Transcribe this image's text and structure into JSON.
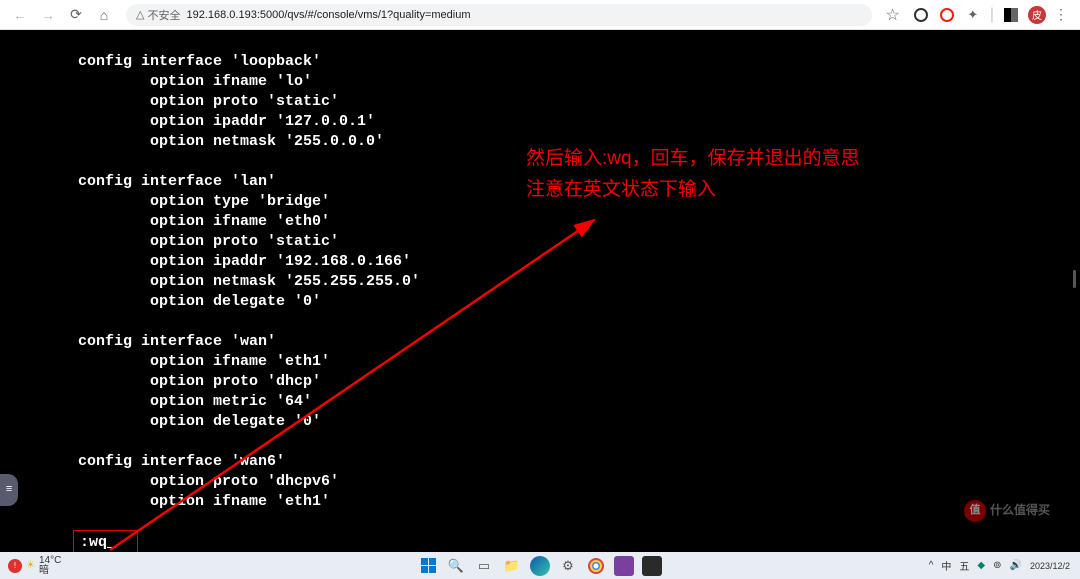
{
  "browser": {
    "security_label": "不安全",
    "url": "192.168.0.193:5000/qvs/#/console/vms/1?quality=medium",
    "avatar_letter": "皮"
  },
  "terminal": {
    "lines": [
      "config interface 'loopback'",
      "        option ifname 'lo'",
      "        option proto 'static'",
      "        option ipaddr '127.0.0.1'",
      "        option netmask '255.0.0.0'",
      "",
      "config interface 'lan'",
      "        option type 'bridge'",
      "        option ifname 'eth0'",
      "        option proto 'static'",
      "        option ipaddr '192.168.0.166'",
      "        option netmask '255.255.255.0'",
      "        option delegate '0'",
      "",
      "config interface 'wan'",
      "        option ifname 'eth1'",
      "        option proto 'dhcp'",
      "        option metric '64'",
      "        option delegate '0'",
      "",
      "config interface 'wan6'",
      "        option proto 'dhcpv6'",
      "        option ifname 'eth1'"
    ],
    "command": ":wq"
  },
  "annotation": {
    "line1": "然后输入:wq，回车，保存并退出的意思",
    "line2": "注意在英文状态下输入"
  },
  "taskbar": {
    "weather_temp": "14°C",
    "weather_desc": "暗",
    "ime_lang": "中",
    "ime_mode": "五",
    "time": "2023/12/2"
  },
  "side_tab": "≡",
  "watermark": {
    "logo": "值",
    "text": "什么值得买"
  }
}
